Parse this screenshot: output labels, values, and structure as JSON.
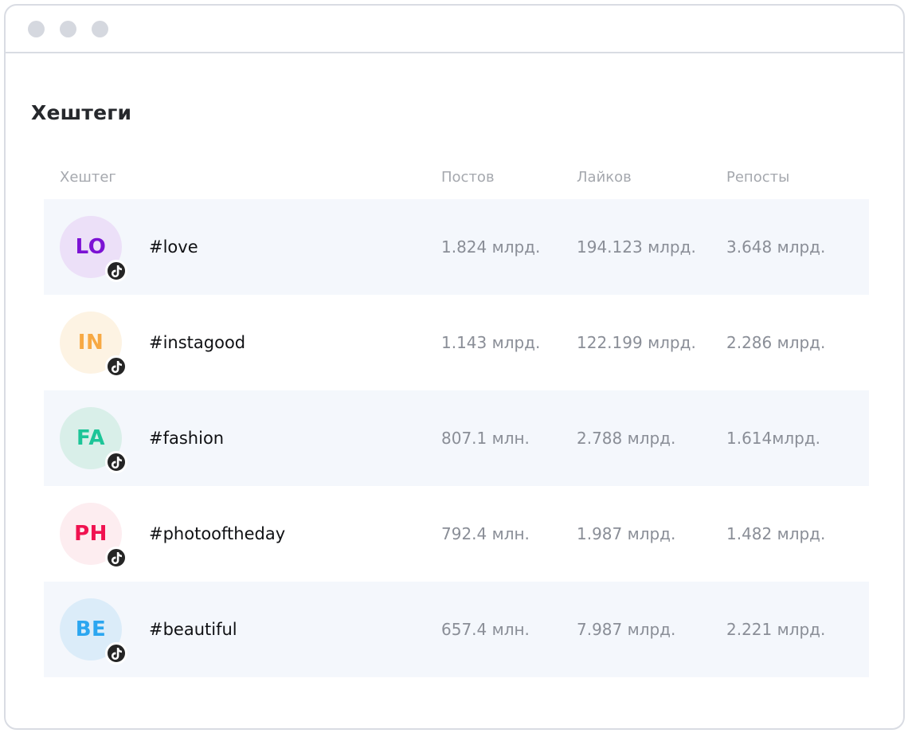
{
  "window": {
    "controls": [
      "dot",
      "dot",
      "dot"
    ]
  },
  "page": {
    "title": "Хештеги"
  },
  "table": {
    "columns": [
      {
        "label": "Хештег"
      },
      {
        "label": "Постов"
      },
      {
        "label": "Лайков"
      },
      {
        "label": "Репосты"
      }
    ],
    "platform_icon": "tiktok",
    "rows": [
      {
        "initials": "LO",
        "hashtag": "#love",
        "posts": "1.824 млрд.",
        "likes": "194.123 млрд.",
        "reposts": "3.648 млрд.",
        "avatar_bg": "#ece0f8",
        "avatar_color": "#7c12d4"
      },
      {
        "initials": "IN",
        "hashtag": "#instagood",
        "posts": "1.143 млрд.",
        "likes": "122.199 млрд.",
        "reposts": "2.286 млрд.",
        "avatar_bg": "#fdf3e3",
        "avatar_color": "#f7a944"
      },
      {
        "initials": "FA",
        "hashtag": "#fashion",
        "posts": "807.1 млн.",
        "likes": "2.788 млрд.",
        "reposts": "1.614млрд.",
        "avatar_bg": "#d9efe9",
        "avatar_color": "#1dc598"
      },
      {
        "initials": "PH",
        "hashtag": "#photooftheday",
        "posts": "792.4 млн.",
        "likes": "1.987 млрд.",
        "reposts": "1.482 млрд.",
        "avatar_bg": "#fdedf0",
        "avatar_color": "#f01250"
      },
      {
        "initials": "BE",
        "hashtag": "#beautiful",
        "posts": "657.4 млн.",
        "likes": "7.987 млрд.",
        "reposts": "2.221 млрд.",
        "avatar_bg": "#dbecf9",
        "avatar_color": "#2ba6f0"
      }
    ]
  },
  "colors": {
    "stripe_bg": "#f4f7fc",
    "header_text": "#a5a8ae",
    "value_text": "#8a8e97",
    "hashtag_text": "#101114",
    "title_text": "#26282c",
    "window_border": "#d9dce3",
    "dot_color": "#d5d8df",
    "badge_bg": "#252525"
  }
}
